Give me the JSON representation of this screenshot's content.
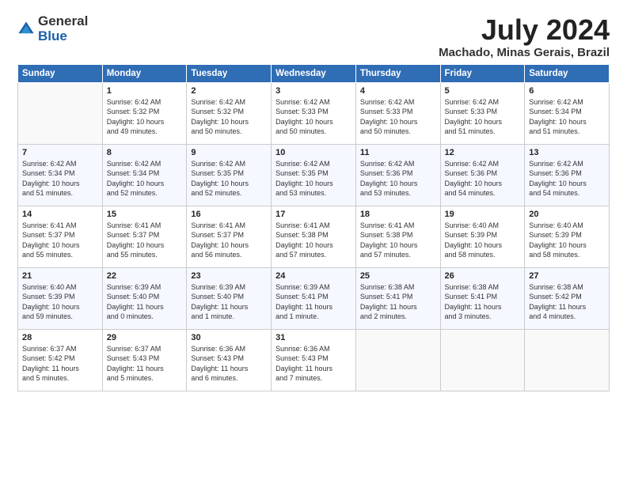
{
  "header": {
    "logo_general": "General",
    "logo_blue": "Blue",
    "title": "July 2024",
    "location": "Machado, Minas Gerais, Brazil"
  },
  "columns": [
    "Sunday",
    "Monday",
    "Tuesday",
    "Wednesday",
    "Thursday",
    "Friday",
    "Saturday"
  ],
  "weeks": [
    [
      {
        "day": "",
        "info": ""
      },
      {
        "day": "1",
        "info": "Sunrise: 6:42 AM\nSunset: 5:32 PM\nDaylight: 10 hours\nand 49 minutes."
      },
      {
        "day": "2",
        "info": "Sunrise: 6:42 AM\nSunset: 5:32 PM\nDaylight: 10 hours\nand 50 minutes."
      },
      {
        "day": "3",
        "info": "Sunrise: 6:42 AM\nSunset: 5:33 PM\nDaylight: 10 hours\nand 50 minutes."
      },
      {
        "day": "4",
        "info": "Sunrise: 6:42 AM\nSunset: 5:33 PM\nDaylight: 10 hours\nand 50 minutes."
      },
      {
        "day": "5",
        "info": "Sunrise: 6:42 AM\nSunset: 5:33 PM\nDaylight: 10 hours\nand 51 minutes."
      },
      {
        "day": "6",
        "info": "Sunrise: 6:42 AM\nSunset: 5:34 PM\nDaylight: 10 hours\nand 51 minutes."
      }
    ],
    [
      {
        "day": "7",
        "info": "Sunrise: 6:42 AM\nSunset: 5:34 PM\nDaylight: 10 hours\nand 51 minutes."
      },
      {
        "day": "8",
        "info": "Sunrise: 6:42 AM\nSunset: 5:34 PM\nDaylight: 10 hours\nand 52 minutes."
      },
      {
        "day": "9",
        "info": "Sunrise: 6:42 AM\nSunset: 5:35 PM\nDaylight: 10 hours\nand 52 minutes."
      },
      {
        "day": "10",
        "info": "Sunrise: 6:42 AM\nSunset: 5:35 PM\nDaylight: 10 hours\nand 53 minutes."
      },
      {
        "day": "11",
        "info": "Sunrise: 6:42 AM\nSunset: 5:36 PM\nDaylight: 10 hours\nand 53 minutes."
      },
      {
        "day": "12",
        "info": "Sunrise: 6:42 AM\nSunset: 5:36 PM\nDaylight: 10 hours\nand 54 minutes."
      },
      {
        "day": "13",
        "info": "Sunrise: 6:42 AM\nSunset: 5:36 PM\nDaylight: 10 hours\nand 54 minutes."
      }
    ],
    [
      {
        "day": "14",
        "info": "Sunrise: 6:41 AM\nSunset: 5:37 PM\nDaylight: 10 hours\nand 55 minutes."
      },
      {
        "day": "15",
        "info": "Sunrise: 6:41 AM\nSunset: 5:37 PM\nDaylight: 10 hours\nand 55 minutes."
      },
      {
        "day": "16",
        "info": "Sunrise: 6:41 AM\nSunset: 5:37 PM\nDaylight: 10 hours\nand 56 minutes."
      },
      {
        "day": "17",
        "info": "Sunrise: 6:41 AM\nSunset: 5:38 PM\nDaylight: 10 hours\nand 57 minutes."
      },
      {
        "day": "18",
        "info": "Sunrise: 6:41 AM\nSunset: 5:38 PM\nDaylight: 10 hours\nand 57 minutes."
      },
      {
        "day": "19",
        "info": "Sunrise: 6:40 AM\nSunset: 5:39 PM\nDaylight: 10 hours\nand 58 minutes."
      },
      {
        "day": "20",
        "info": "Sunrise: 6:40 AM\nSunset: 5:39 PM\nDaylight: 10 hours\nand 58 minutes."
      }
    ],
    [
      {
        "day": "21",
        "info": "Sunrise: 6:40 AM\nSunset: 5:39 PM\nDaylight: 10 hours\nand 59 minutes."
      },
      {
        "day": "22",
        "info": "Sunrise: 6:39 AM\nSunset: 5:40 PM\nDaylight: 11 hours\nand 0 minutes."
      },
      {
        "day": "23",
        "info": "Sunrise: 6:39 AM\nSunset: 5:40 PM\nDaylight: 11 hours\nand 1 minute."
      },
      {
        "day": "24",
        "info": "Sunrise: 6:39 AM\nSunset: 5:41 PM\nDaylight: 11 hours\nand 1 minute."
      },
      {
        "day": "25",
        "info": "Sunrise: 6:38 AM\nSunset: 5:41 PM\nDaylight: 11 hours\nand 2 minutes."
      },
      {
        "day": "26",
        "info": "Sunrise: 6:38 AM\nSunset: 5:41 PM\nDaylight: 11 hours\nand 3 minutes."
      },
      {
        "day": "27",
        "info": "Sunrise: 6:38 AM\nSunset: 5:42 PM\nDaylight: 11 hours\nand 4 minutes."
      }
    ],
    [
      {
        "day": "28",
        "info": "Sunrise: 6:37 AM\nSunset: 5:42 PM\nDaylight: 11 hours\nand 5 minutes."
      },
      {
        "day": "29",
        "info": "Sunrise: 6:37 AM\nSunset: 5:43 PM\nDaylight: 11 hours\nand 5 minutes."
      },
      {
        "day": "30",
        "info": "Sunrise: 6:36 AM\nSunset: 5:43 PM\nDaylight: 11 hours\nand 6 minutes."
      },
      {
        "day": "31",
        "info": "Sunrise: 6:36 AM\nSunset: 5:43 PM\nDaylight: 11 hours\nand 7 minutes."
      },
      {
        "day": "",
        "info": ""
      },
      {
        "day": "",
        "info": ""
      },
      {
        "day": "",
        "info": ""
      }
    ]
  ]
}
